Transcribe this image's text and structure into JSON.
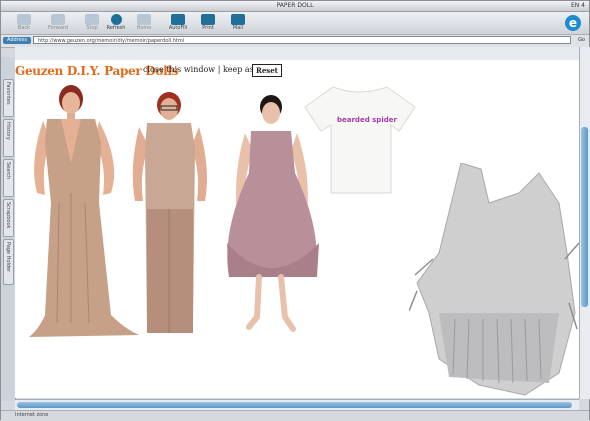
{
  "window": {
    "title": "PAPER DOLL",
    "right_info": "EN 4"
  },
  "toolbar": {
    "buttons": [
      {
        "label": "Back",
        "icon": "back-arrow-icon"
      },
      {
        "label": "Forward",
        "icon": "forward-arrow-icon"
      },
      {
        "label": "Stop",
        "icon": "stop-icon"
      },
      {
        "label": "Refresh",
        "icon": "refresh-icon"
      },
      {
        "label": "Home",
        "icon": "home-icon"
      },
      {
        "label": "AutoFill",
        "icon": "autofill-icon"
      },
      {
        "label": "Print",
        "icon": "print-icon"
      },
      {
        "label": "Mail",
        "icon": "mail-icon"
      }
    ],
    "logo_letter": "e"
  },
  "address_bar": {
    "label": "Address",
    "url": "http://www.geuzen.org/memoir/diy/memoir/paperdoll.html",
    "go": "Go"
  },
  "sidebar": {
    "tabs": [
      "Favorites",
      "History",
      "Search",
      "Scrapbook",
      "Page Holder"
    ]
  },
  "page": {
    "title": "Geuzen D.I.Y. Paper Dolls",
    "subtitle": "close this window | keep as po",
    "reset_label": "Reset",
    "shirt_text": "bearded spider"
  },
  "status": {
    "text": "Internet zone"
  },
  "colors": {
    "title_orange": "#e06a1a",
    "accent_blue": "#1f6f9a",
    "shirt_text": "#a23caa"
  }
}
